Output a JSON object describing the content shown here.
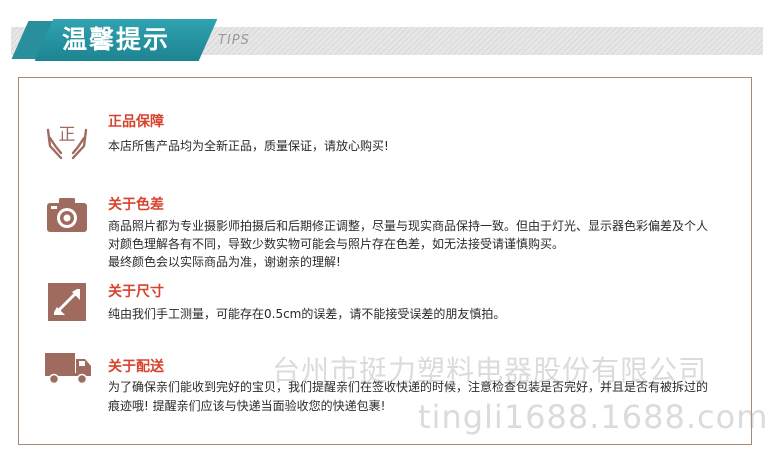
{
  "header": {
    "title": "温馨提示",
    "subtitle": "TIPS"
  },
  "colors": {
    "accent": "#2a8f9c",
    "tab": "#1e8391",
    "icon_brown": "#a06b5f",
    "section_title_red": "#d8432e",
    "panel_border": "#a58976"
  },
  "sections": [
    {
      "icon": "genuine-hands-icon",
      "icon_char": "正",
      "title": "正品保障",
      "lines": [
        "本店所售产品均为全新正品，质量保证，请放心购买!"
      ]
    },
    {
      "icon": "camera-icon",
      "title": "关于色差",
      "lines": [
        "商品照片都为专业摄影师拍摄后和后期修正调整，尽量与现实商品保持一致。但由于灯光、显示器色彩偏差及个人",
        "对颜色理解各有不同，导致少数实物可能会与照片存在色差，如无法接受请谨慎购买。",
        "最终颜色会以实际商品为准，谢谢亲的理解!"
      ]
    },
    {
      "icon": "resize-arrow-icon",
      "title": "关于尺寸",
      "lines": [
        "纯由我们手工测量，可能存在0.5cm的误差，请不能接受误差的朋友慎拍。"
      ]
    },
    {
      "icon": "delivery-truck-icon",
      "title": "关于配送",
      "lines": [
        "为了确保亲们能收到完好的宝贝，我们提醒亲们在签收快递的时候，注意检查包装是否完好，并且是否有被拆过的",
        "痕迹哦! 提醒亲们应该与快递当面验收您的快递包裹!"
      ]
    }
  ],
  "watermark": {
    "company": "台州市挺力塑料电器股份有限公司",
    "domain": "tingli1688.1688.com"
  }
}
